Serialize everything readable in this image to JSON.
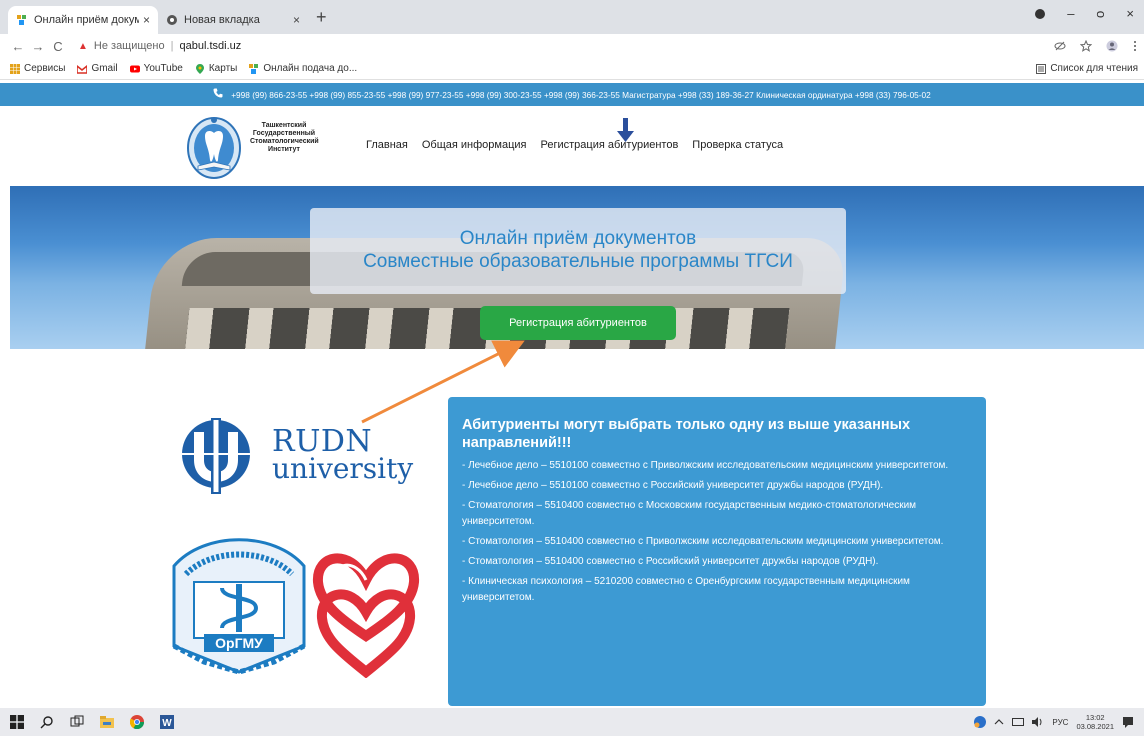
{
  "browser": {
    "tabs": [
      {
        "title": "Онлайн приём документов",
        "close": "×"
      },
      {
        "title": "Новая вкладка",
        "close": "×"
      }
    ],
    "new_tab": "+",
    "window_controls": {
      "minimize": "–",
      "maximize": "ᴑ",
      "close": "×"
    },
    "nav": {
      "back": "←",
      "forward": "→",
      "reload": "C"
    },
    "address": {
      "warning_icon": "▲",
      "security_text": "Не защищено",
      "separator": "|",
      "host": "qabul.tsdi.uz"
    },
    "bookmarks": [
      {
        "label": "Сервисы",
        "icon": "apps-icon",
        "color": "#e3a21a"
      },
      {
        "label": "Gmail",
        "icon": "gmail-icon",
        "color": "#d93025"
      },
      {
        "label": "YouTube",
        "icon": "youtube-icon",
        "color": "#ff0000"
      },
      {
        "label": "Карты",
        "icon": "maps-icon",
        "color": "#34a853"
      },
      {
        "label": "Онлайн подача до...",
        "icon": "site-icon",
        "color": "#4caf50"
      }
    ],
    "reading_list": "Список для чтения"
  },
  "page": {
    "phonebar": "+998 (99) 866-23-55   +998 (99) 855-23-55   +998 (99) 977-23-55   +998 (99) 300-23-55   +998 (99) 366-23-55   Магистратура +998 (33) 189-36-27   Клиническая ординатура +998 (33) 796-05-02",
    "logo_text": "Ташкентский Государственный Стоматологический Институт",
    "menu": [
      "Главная",
      "Общая информация",
      "Регистрация абитуриентов",
      "Проверка статуса"
    ],
    "hero": {
      "line1": "Онлайн приём документов",
      "line2": "Совместные образовательные программы ТГСИ",
      "button": "Регистрация абитуриентов"
    },
    "rudn": {
      "line1": "RUDN",
      "line2": "university"
    },
    "orgmu_label": "ОрГМУ",
    "info": {
      "title": "Абитуриенты могут выбрать только одну из выше указанных направлений!!!",
      "items": [
        "- Лечебное дело – 5510100 совместно с Приволжским исследовательским медицинским университетом.",
        "- Лечебное дело – 5510100 совместно с Российский университет дружбы народов (РУДН).",
        "- Стоматология – 5510400 совместно с Московским государственным медико-стоматологическим университетом.",
        "- Стоматология – 5510400 совместно с Приволжским исследовательским медицинским университетом.",
        "- Стоматология – 5510400 совместно с Российский университет дружбы народов (РУДН).",
        "- Клиническая психология – 5210200 совместно с Оренбургским государственным медицинским университетом."
      ]
    },
    "colors": {
      "topbar": "#3a91c9",
      "button": "#29a745",
      "info_bg": "#3d9ad3",
      "annotation_arrow": "#f08a3c",
      "annotation_down": "#2b4f9c"
    }
  },
  "taskbar": {
    "lang": "РУС",
    "time": "13:02",
    "date": "03.08.2021"
  }
}
